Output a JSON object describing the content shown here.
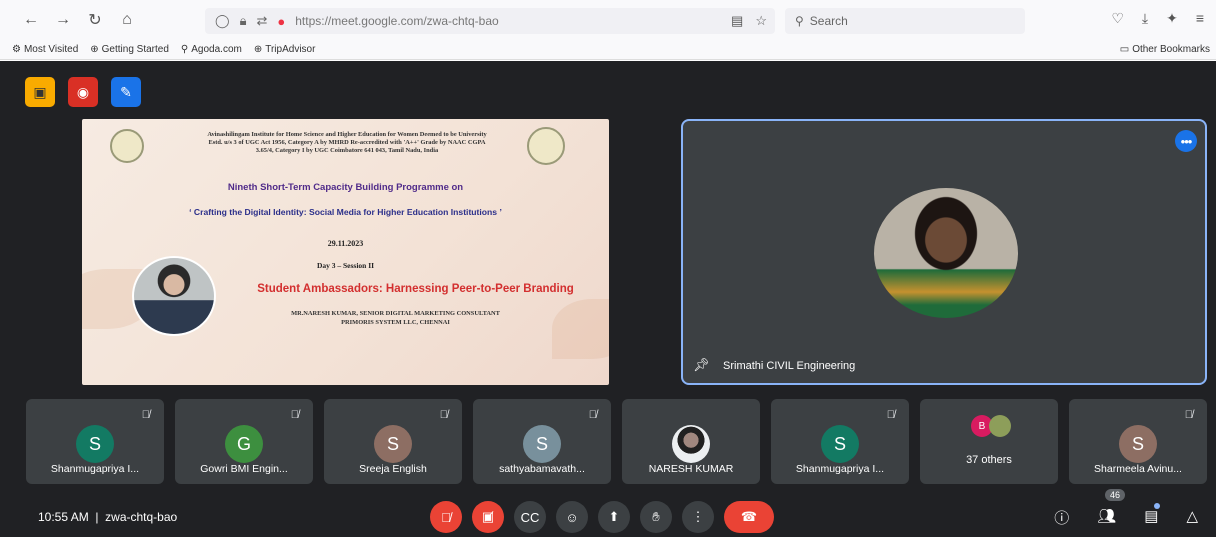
{
  "browser": {
    "url_host": "https://meet.google.com",
    "url_path": "/zwa-chtq-bao",
    "search_placeholder": "Search",
    "bookmarks": [
      "Most Visited",
      "Getting Started",
      "Agoda.com",
      "TripAdvisor"
    ],
    "other_bookmarks": "Other Bookmarks"
  },
  "slide": {
    "institution": "Avinashilingam Institute for Home Science and Higher Education for Women Deemed to be University Estd. u/s 3 of UGC Act 1956, Category A by MHRD Re-accredited with 'A++' Grade by NAAC CGPA 3.65/4, Category I by UGC Coimbatore 641 043, Tamil Nadu, India",
    "programme": "Nineth Short-Term Capacity Building Programme on",
    "theme": "‘ Crafting the Digital Identity: Social Media for Higher Education Institutions ’",
    "date": "29.11.2023",
    "session": "Day 3 – Session II",
    "title": "Student Ambassadors: Harnessing Peer-to-Peer Branding",
    "speaker_line1": "MR.NARESH KUMAR, SENIOR DIGITAL MARKETING CONSULTANT",
    "speaker_line2": "PRIMORIS SYSTEM LLC, CHENNAI"
  },
  "main_participant": {
    "name": "Srimathi CIVIL Engineering"
  },
  "participants": [
    {
      "initial": "S",
      "name": "Shanmugapriya I...",
      "color": "#137a63",
      "muted": true
    },
    {
      "initial": "G",
      "name": "Gowri BMI Engin...",
      "color": "#3d8f3f",
      "muted": true
    },
    {
      "initial": "S",
      "name": "Sreeja English",
      "color": "#8d6e63",
      "muted": true
    },
    {
      "initial": "S",
      "name": "sathyabamavath...",
      "color": "#78909c",
      "muted": true
    },
    {
      "initial": "",
      "name": "NARESH KUMAR",
      "color": "#cfd8dc",
      "muted": false
    },
    {
      "initial": "S",
      "name": "Shanmugapriya I...",
      "color": "#137a63",
      "muted": true
    }
  ],
  "others": {
    "label": "37 others",
    "badge_initial": "B"
  },
  "last_participant": {
    "initial": "S",
    "name": "Sharmeela Avinu...",
    "color": "#8d6e63"
  },
  "bottom": {
    "time": "10:55 AM",
    "meeting_code": "zwa-chtq-bao",
    "people_count": "46"
  }
}
